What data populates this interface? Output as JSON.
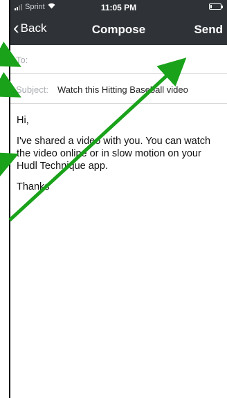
{
  "status_bar": {
    "carrier": "Sprint",
    "time": "11:05 PM",
    "battery_level": 0.15
  },
  "nav": {
    "back_label": "Back",
    "title": "Compose",
    "send_label": "Send"
  },
  "to_field": {
    "label": "To:",
    "value": ""
  },
  "subject_field": {
    "label": "Subject:",
    "value": "Watch this Hitting Baseball video"
  },
  "message": {
    "greeting": "Hi,",
    "line1": "I've shared a video with you. You can watch the video online or in slow motion on your Hudl Technique app.",
    "closing": "Thanks"
  },
  "annotations": {
    "arrow_color": "#1aa21a"
  }
}
